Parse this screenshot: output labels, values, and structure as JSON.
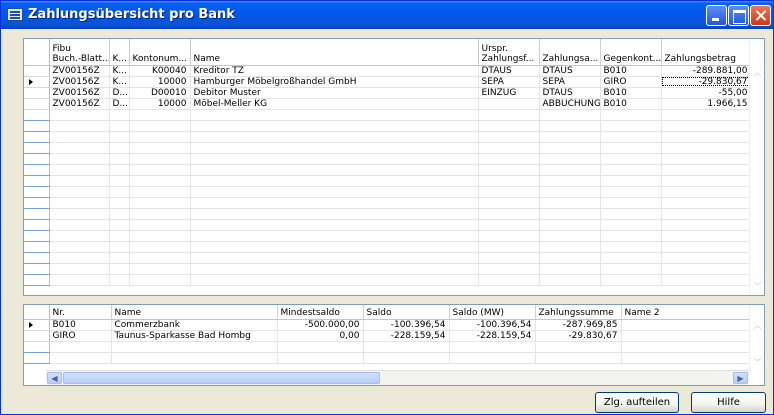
{
  "window": {
    "title": "Zahlungsübersicht pro Bank"
  },
  "top_grid": {
    "headers": [
      {
        "line1": "Fibu",
        "line2": "Buch.-Blatt..."
      },
      {
        "line1": "",
        "line2": "K..."
      },
      {
        "line1": "",
        "line2": "Kontonum..."
      },
      {
        "line1": "",
        "line2": "Name"
      },
      {
        "line1": "Urspr.",
        "line2": "Zahlungsf..."
      },
      {
        "line1": "",
        "line2": "Zahlungsa..."
      },
      {
        "line1": "",
        "line2": "Gegenkont..."
      },
      {
        "line1": "",
        "line2": "Zahlungsbetrag"
      }
    ],
    "rows": [
      [
        "ZV00156Z",
        "K...",
        "K00040",
        "Kreditor TZ",
        "DTAUS",
        "DTAUS",
        "B010",
        "-289.881,00"
      ],
      [
        "ZV00156Z",
        "K...",
        "10000",
        "Hamburger Möbelgroßhandel GmbH",
        "SEPA",
        "SEPA",
        "GIRO",
        "-29.830,67"
      ],
      [
        "ZV00156Z",
        "D...",
        "D00010",
        "Debitor Muster",
        "EINZUG",
        "DTAUS",
        "B010",
        "-55,00"
      ],
      [
        "ZV00156Z",
        "D...",
        "10000",
        "Möbel-Meller KG",
        "",
        "ABBUCHUNG",
        "B010",
        "1.966,15"
      ]
    ]
  },
  "bottom_grid": {
    "headers": [
      "Nr.",
      "Name",
      "Mindestsaldo",
      "Saldo",
      "Saldo (MW)",
      "Zahlungssumme",
      "Name 2"
    ],
    "rows": [
      [
        "B010",
        "Commerzbank",
        "-500.000,00",
        "-100.396,54",
        "-100.396,54",
        "-287.969,85",
        ""
      ],
      [
        "GIRO",
        "Taunus-Sparkasse Bad Hombg",
        "0,00",
        "-228.159,54",
        "-228.159,54",
        "-29.830,67",
        ""
      ]
    ]
  },
  "buttons": {
    "split": "Zlg. aufteilen",
    "help": "Hilfe"
  },
  "colors": {
    "titlebar": "#0058EE",
    "close": "#C93A18",
    "window_bg": "#ECE9D8"
  }
}
